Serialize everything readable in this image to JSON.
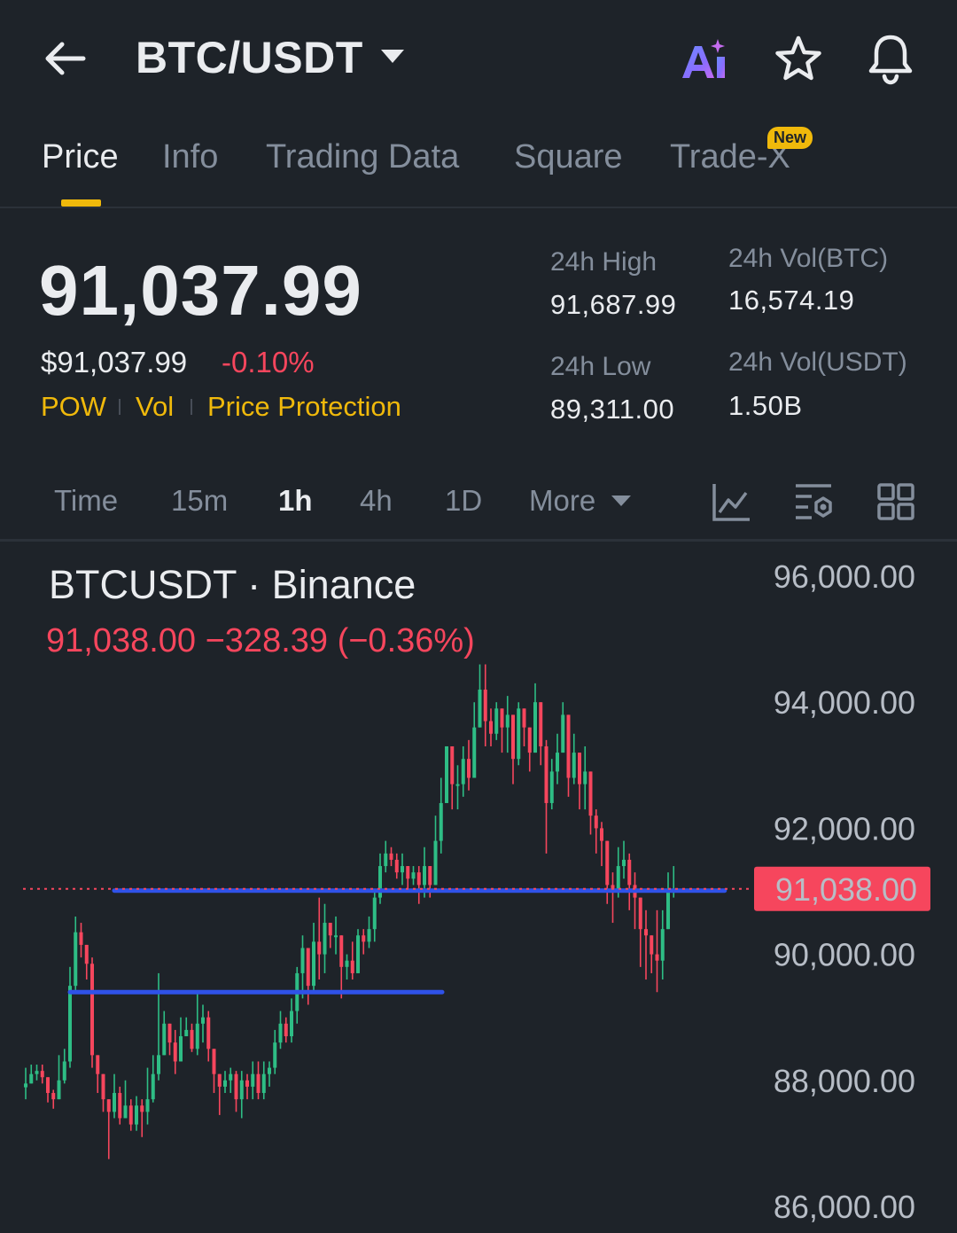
{
  "header": {
    "pair": "BTC/USDT",
    "back_icon": "arrow-left-icon",
    "ai_icon": "ai-icon",
    "star_icon": "star-icon",
    "bell_icon": "bell-icon"
  },
  "tabs": [
    {
      "label": "Price",
      "active": true
    },
    {
      "label": "Info",
      "active": false
    },
    {
      "label": "Trading Data",
      "active": false
    },
    {
      "label": "Square",
      "active": false
    },
    {
      "label": "Trade-X",
      "active": false,
      "badge": "New"
    }
  ],
  "price": {
    "last": "91,037.99",
    "usd": "$91,037.99",
    "change": "-0.10%",
    "tags": [
      "POW",
      "Vol",
      "Price Protection"
    ]
  },
  "stats": {
    "high_label": "24h High",
    "high_value": "91,687.99",
    "low_label": "24h Low",
    "low_value": "89,311.00",
    "vol_btc_label": "24h Vol(BTC)",
    "vol_btc_value": "16,574.19",
    "vol_usdt_label": "24h Vol(USDT)",
    "vol_usdt_value": "1.50B"
  },
  "intervals": [
    {
      "label": "Time",
      "active": false
    },
    {
      "label": "15m",
      "active": false
    },
    {
      "label": "1h",
      "active": true
    },
    {
      "label": "4h",
      "active": false
    },
    {
      "label": "1D",
      "active": false
    },
    {
      "label": "More",
      "active": false
    }
  ],
  "tools": [
    "chart-line-icon",
    "indicator-settings-icon",
    "grid-layout-icon"
  ],
  "chart_data": {
    "type": "candlestick",
    "title": "BTCUSDT · Binance",
    "ohlc_summary": "91,038.00  −328.39 (−0.36%)",
    "y_ticks": [
      "96,000.00",
      "94,000.00",
      "92,000.00",
      "90,000.00",
      "88,000.00",
      "86,000.00"
    ],
    "y_tick_values": [
      96000,
      94000,
      92000,
      90000,
      88000,
      86000
    ],
    "ylim": [
      85500,
      96400
    ],
    "current_price_label": "91,038.00",
    "current_price": 91038,
    "up_color": "#2ebd85",
    "down_color": "#f6465d",
    "drawn_lines": [
      {
        "from_index": 16,
        "to_index": 115,
        "price": 91010,
        "color": "#2f52e8"
      },
      {
        "from_index": 8,
        "to_index": 64,
        "price": 89400,
        "color": "#2f52e8"
      }
    ],
    "closes": [
      87950,
      88100,
      88150,
      88050,
      87800,
      87700,
      88000,
      88300,
      89500,
      90350,
      90150,
      89850,
      88400,
      88100,
      87700,
      87500,
      87800,
      87400,
      87600,
      87300,
      87600,
      87500,
      87700,
      88100,
      88400,
      88900,
      88600,
      88300,
      88700,
      88800,
      88500,
      88900,
      89000,
      88500,
      88100,
      87900,
      88000,
      88100,
      87700,
      88000,
      87900,
      88100,
      87800,
      88100,
      88200,
      88600,
      88900,
      88700,
      89100,
      89700,
      90100,
      89500,
      90200,
      90000,
      90500,
      90300,
      90300,
      89800,
      89900,
      89700,
      90300,
      90200,
      90400,
      90900,
      91400,
      91600,
      91500,
      91300,
      91400,
      91200,
      91300,
      91100,
      91400,
      91100,
      91800,
      92400,
      93300,
      92700,
      92700,
      93100,
      92800,
      93600,
      94200,
      93700,
      93500,
      93900,
      93600,
      93800,
      93100,
      93900,
      93600,
      93200,
      94000,
      93300,
      92400,
      92900,
      93200,
      93800,
      92800,
      93200,
      92700,
      92900,
      92200,
      92000,
      91800,
      91100,
      91000,
      91400,
      91500,
      91100,
      90900,
      90400,
      90300,
      90000,
      89900,
      90400,
      91000,
      91038
    ],
    "ranges": [
      [
        87700,
        88200
      ],
      [
        87950,
        88250
      ],
      [
        88000,
        88250
      ],
      [
        87950,
        88250
      ],
      [
        87650,
        87900
      ],
      [
        87550,
        87850
      ],
      [
        87700,
        88400
      ],
      [
        87950,
        88500
      ],
      [
        88200,
        89800
      ],
      [
        89400,
        90600
      ],
      [
        89950,
        90500
      ],
      [
        89600,
        90150
      ],
      [
        88200,
        89950
      ],
      [
        87800,
        88400
      ],
      [
        87500,
        88000
      ],
      [
        86750,
        87700
      ],
      [
        87400,
        88100
      ],
      [
        87300,
        87900
      ],
      [
        87500,
        88000
      ],
      [
        87200,
        87700
      ],
      [
        87200,
        87750
      ],
      [
        87100,
        87700
      ],
      [
        87300,
        88200
      ],
      [
        87650,
        88400
      ],
      [
        88000,
        89700
      ],
      [
        88500,
        89100
      ],
      [
        88400,
        88800
      ],
      [
        88100,
        88800
      ],
      [
        88600,
        89000
      ],
      [
        88700,
        89000
      ],
      [
        88450,
        88900
      ],
      [
        88400,
        89400
      ],
      [
        88600,
        89200
      ],
      [
        88300,
        89100
      ],
      [
        87800,
        88500
      ],
      [
        87450,
        88100
      ],
      [
        87800,
        88150
      ],
      [
        87800,
        88200
      ],
      [
        87500,
        88150
      ],
      [
        87400,
        88150
      ],
      [
        87700,
        88100
      ],
      [
        87700,
        88300
      ],
      [
        87700,
        88300
      ],
      [
        87700,
        88300
      ],
      [
        87900,
        88300
      ],
      [
        88100,
        88800
      ],
      [
        88500,
        89100
      ],
      [
        88600,
        89000
      ],
      [
        88600,
        89300
      ],
      [
        88900,
        89800
      ],
      [
        89300,
        90300
      ],
      [
        89200,
        89700
      ],
      [
        89400,
        90500
      ],
      [
        89600,
        90900
      ],
      [
        89700,
        90800
      ],
      [
        90100,
        90500
      ],
      [
        90000,
        90600
      ],
      [
        89300,
        90000
      ],
      [
        89600,
        90000
      ],
      [
        89600,
        90200
      ],
      [
        89700,
        90400
      ],
      [
        90000,
        90400
      ],
      [
        90100,
        90600
      ],
      [
        90200,
        91000
      ],
      [
        90800,
        91600
      ],
      [
        91300,
        91800
      ],
      [
        91400,
        91700
      ],
      [
        91200,
        91600
      ],
      [
        91100,
        91600
      ],
      [
        91000,
        91400
      ],
      [
        91100,
        91400
      ],
      [
        90800,
        91400
      ],
      [
        90900,
        91700
      ],
      [
        90900,
        91400
      ],
      [
        91100,
        92200
      ],
      [
        91600,
        92800
      ],
      [
        92400,
        93200
      ],
      [
        92300,
        93200
      ],
      [
        92300,
        93000
      ],
      [
        92500,
        93300
      ],
      [
        92600,
        93400
      ],
      [
        92800,
        94000
      ],
      [
        93600,
        94600
      ],
      [
        93300,
        94600
      ],
      [
        93300,
        93900
      ],
      [
        93400,
        94000
      ],
      [
        93200,
        93900
      ],
      [
        93200,
        94100
      ],
      [
        92700,
        93600
      ],
      [
        93000,
        94000
      ],
      [
        93300,
        93900
      ],
      [
        92900,
        93500
      ],
      [
        93200,
        94300
      ],
      [
        93000,
        94000
      ],
      [
        91600,
        93400
      ],
      [
        92300,
        93100
      ],
      [
        92700,
        93500
      ],
      [
        93200,
        94000
      ],
      [
        92500,
        93300
      ],
      [
        92700,
        93500
      ],
      [
        92300,
        93100
      ],
      [
        92300,
        93300
      ],
      [
        91900,
        92500
      ],
      [
        91600,
        92300
      ],
      [
        91400,
        92100
      ],
      [
        90800,
        91600
      ],
      [
        90500,
        91300
      ],
      [
        90900,
        91700
      ],
      [
        91200,
        91800
      ],
      [
        90700,
        91600
      ],
      [
        90400,
        91300
      ],
      [
        89800,
        90900
      ],
      [
        89600,
        90700
      ],
      [
        89700,
        90300
      ],
      [
        89400,
        90700
      ],
      [
        89600,
        90700
      ],
      [
        90600,
        91300
      ],
      [
        90900,
        91400
      ]
    ]
  }
}
